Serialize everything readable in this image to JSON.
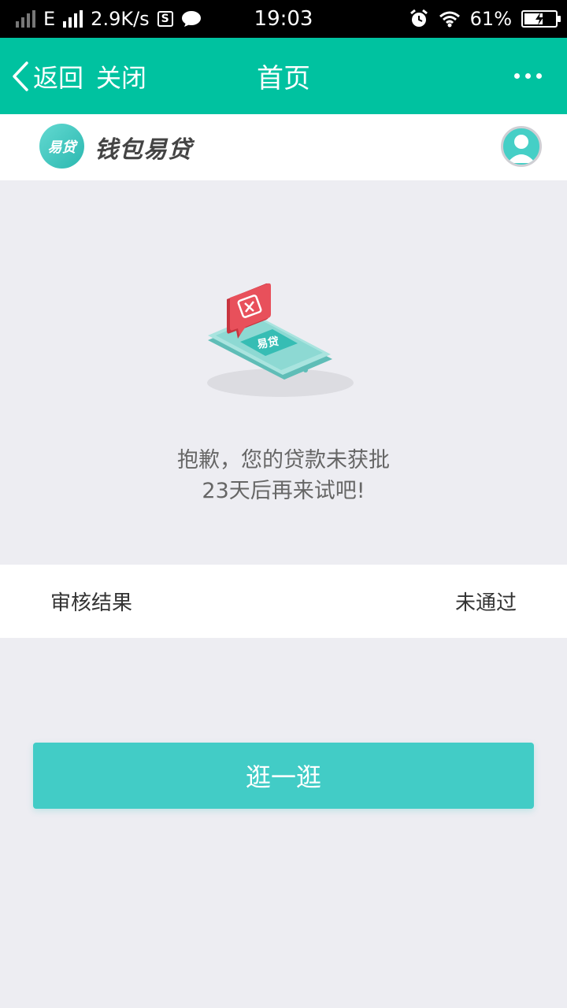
{
  "status_bar": {
    "network_type": "E",
    "speed": "2.9K/s",
    "s_badge": "S",
    "time": "19:03",
    "battery": "61%",
    "battery_level": 0.61,
    "icons": [
      "signal-icon",
      "chat-bubble-icon",
      "alarm-icon",
      "wifi-icon",
      "battery-charging-icon"
    ]
  },
  "nav": {
    "back_label": "返回",
    "close_label": "关闭",
    "title": "首页",
    "more_icon": "more-dots-icon"
  },
  "header": {
    "logo_text": "易贷",
    "brand_name": "钱包易贷",
    "avatar_icon": "user-avatar-icon"
  },
  "illustration": {
    "icon": "phone-rejected-icon",
    "screen_text": "易贷"
  },
  "message": {
    "line1": "抱歉，您的贷款未获批",
    "line2": "23天后再来试吧!"
  },
  "result": {
    "label": "审核结果",
    "value": "未通过"
  },
  "button": {
    "label": "逛一逛"
  },
  "colors": {
    "nav_bg": "#00c2a0",
    "button_bg": "#42ccc6",
    "page_bg": "#ededf2",
    "alert_red": "#e8505b"
  }
}
